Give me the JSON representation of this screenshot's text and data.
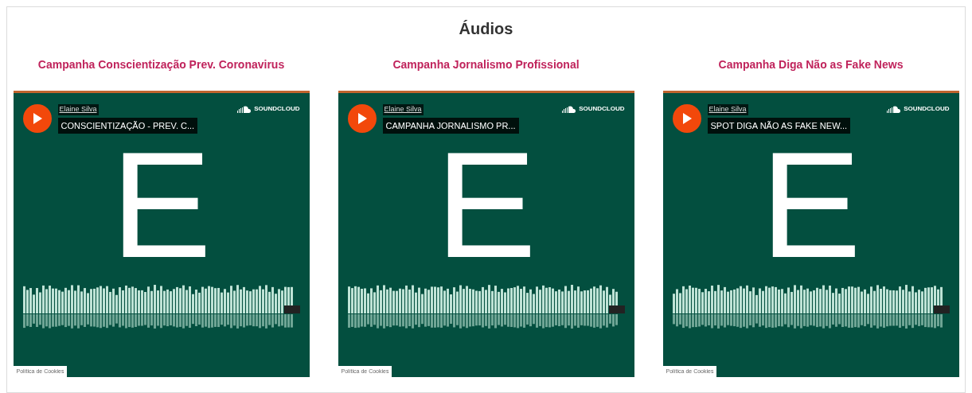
{
  "title": "Áudios",
  "players": [
    {
      "heading": "Campanha Conscientização Prev. Coronavirus",
      "artist": "Elaine Silva",
      "track": "CONSCIENTIZAÇÃO - PREV. C...",
      "brand": "SOUNDCLOUD",
      "cover_letter": "E",
      "cookies": "Política de Cookies"
    },
    {
      "heading": "Campanha Jornalismo Profissional",
      "artist": "Elaine Silva",
      "track": "CAMPANHA JORNALISMO PR...",
      "brand": "SOUNDCLOUD",
      "cover_letter": "E",
      "cookies": "Política de Cookies"
    },
    {
      "heading": "Campanha Diga Não as Fake News",
      "artist": "Elaine Silva",
      "track": "SPOT DIGA NÃO AS FAKE NEW...",
      "brand": "SOUNDCLOUD",
      "cover_letter": "E",
      "cookies": "Política de Cookies"
    }
  ]
}
